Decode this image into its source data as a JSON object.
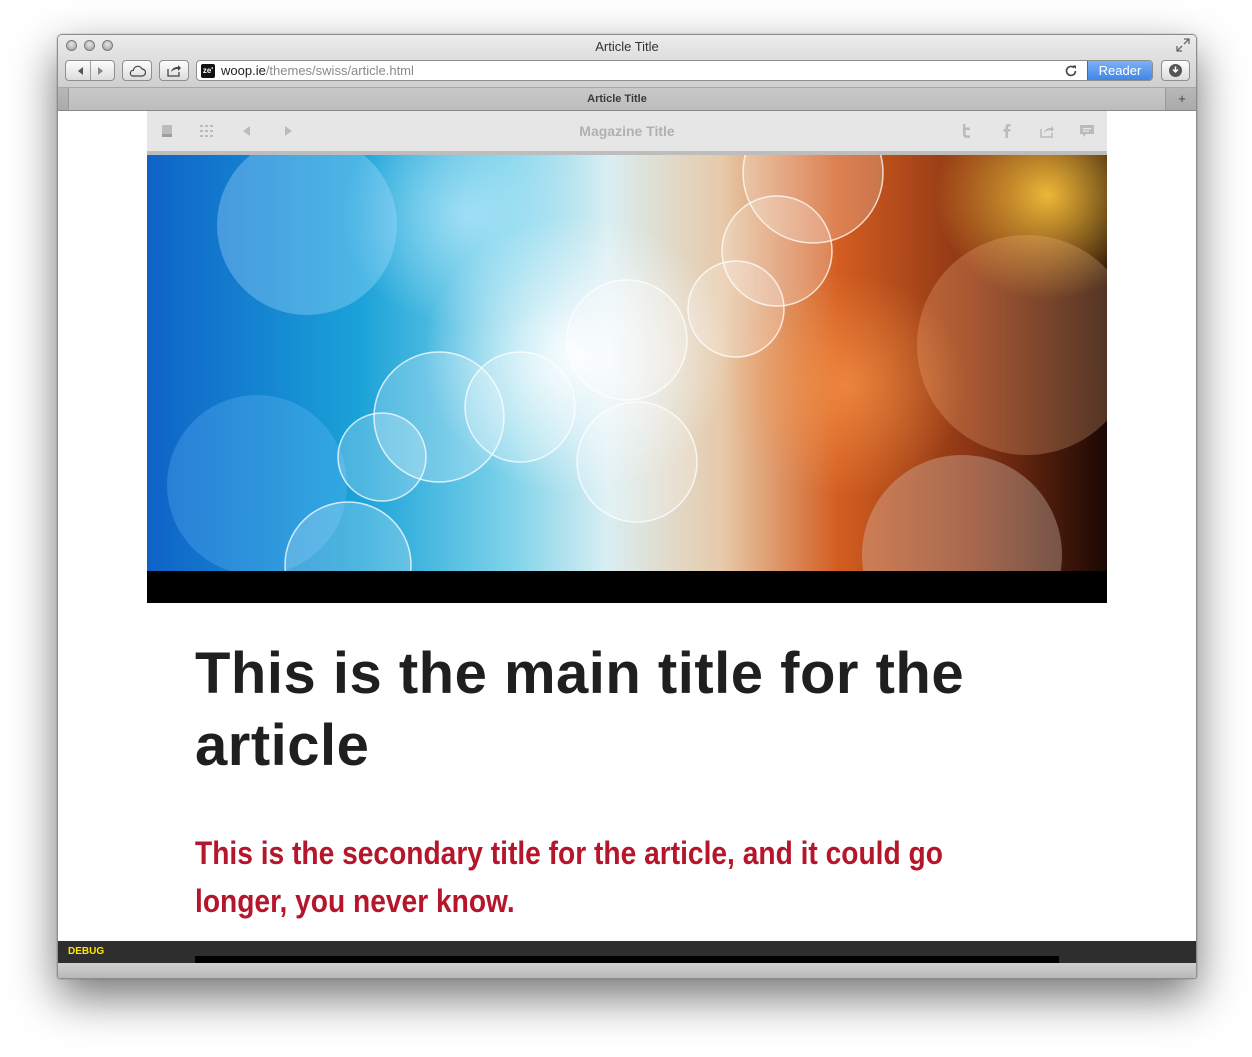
{
  "window": {
    "title": "Article Title"
  },
  "toolbar": {
    "back_icon": "back-arrow-icon",
    "forward_icon": "forward-arrow-icon",
    "icloud_icon": "cloud-icon",
    "share_icon": "share-icon",
    "download_icon": "download-icon",
    "reload_icon": "reload-icon",
    "reader_label": "Reader"
  },
  "address": {
    "favicon_text": "ze'",
    "host": "woop.ie",
    "path": "/themes/swiss/article.html"
  },
  "tabs": [
    {
      "label": "Article Title"
    }
  ],
  "new_tab_label": "+",
  "magazine": {
    "title": "Magazine Title",
    "left_icons": [
      "book-icon",
      "grid-icon",
      "previous-icon",
      "next-icon"
    ],
    "right_icons": [
      "twitter-icon",
      "facebook-icon",
      "share-icon",
      "comment-icon"
    ]
  },
  "article": {
    "main_title": "This is the main title for the article",
    "secondary_title": "This is the secondary title for the article, and it could go longer, you never know."
  },
  "debug": {
    "label": "DEBUG"
  },
  "colors": {
    "secondary_title": "#b5162b",
    "debug_label": "#ffe600",
    "reader_button": "#3f86e8"
  }
}
